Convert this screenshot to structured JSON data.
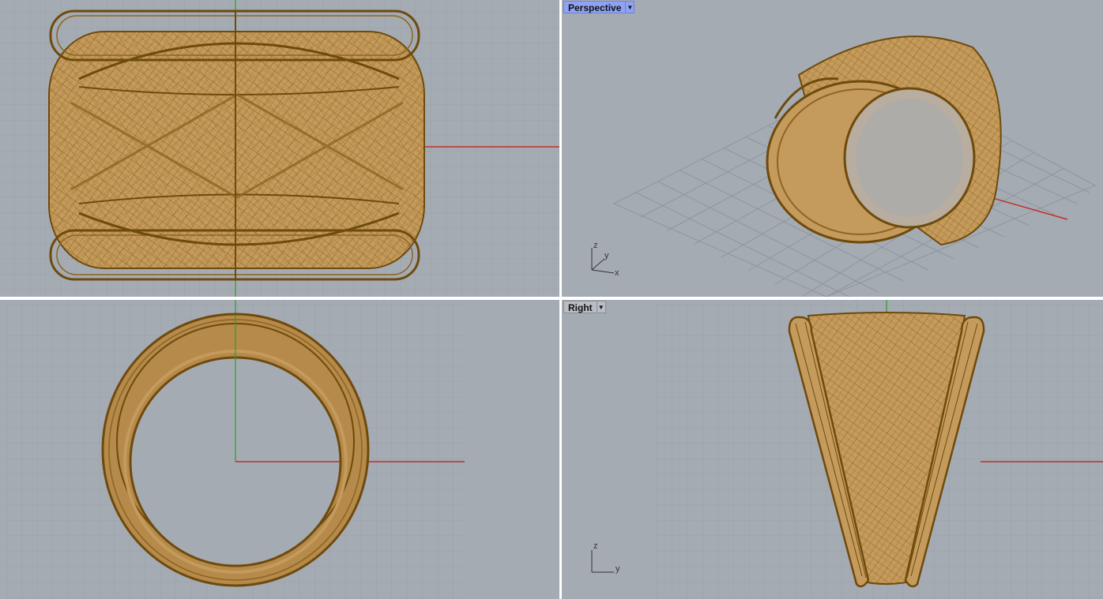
{
  "viewports": {
    "top": {
      "label": ""
    },
    "perspective": {
      "label": "Perspective",
      "menu_icon": "dropdown-arrow-icon",
      "active": true,
      "axis_labels": {
        "z": "z",
        "y": "y",
        "x": "x"
      }
    },
    "front": {
      "label": ""
    },
    "right": {
      "label": "Right",
      "menu_icon": "dropdown-arrow-icon",
      "axis_labels": {
        "z": "z",
        "y": "y"
      }
    }
  },
  "colors": {
    "viewport_bg": "#a5abb3",
    "grid_minor": "#9aa0a8",
    "grid_major": "#878d95",
    "axis_x": "#c0302a",
    "axis_y": "#2aa02a",
    "wire_dark": "#6e4a0c",
    "wire_light": "#b58a4a",
    "active_tab": "#8fa3f2"
  }
}
